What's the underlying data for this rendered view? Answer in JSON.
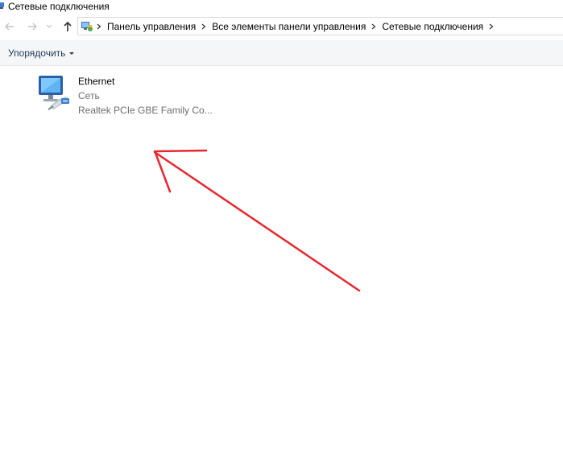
{
  "window": {
    "title": "Сетевые подключения"
  },
  "nav": {
    "icons": [
      "back-arrow-icon",
      "forward-arrow-icon",
      "recent-locations-chevron-icon",
      "up-arrow-icon"
    ]
  },
  "breadcrumb": [
    {
      "label": "Панель управления"
    },
    {
      "label": "Все элементы панели управления"
    },
    {
      "label": "Сетевые подключения"
    }
  ],
  "toolbar": {
    "organize_label": "Упорядочить"
  },
  "connections": [
    {
      "name": "Ethernet",
      "status": "Сеть",
      "device": "Realtek PCIe GBE Family Co...",
      "icon": "network-adapter-icon"
    }
  ],
  "colors": {
    "annotation_arrow": "#e8262d",
    "link_text": "#1e395b",
    "secondary_text": "#6d6d6d"
  }
}
